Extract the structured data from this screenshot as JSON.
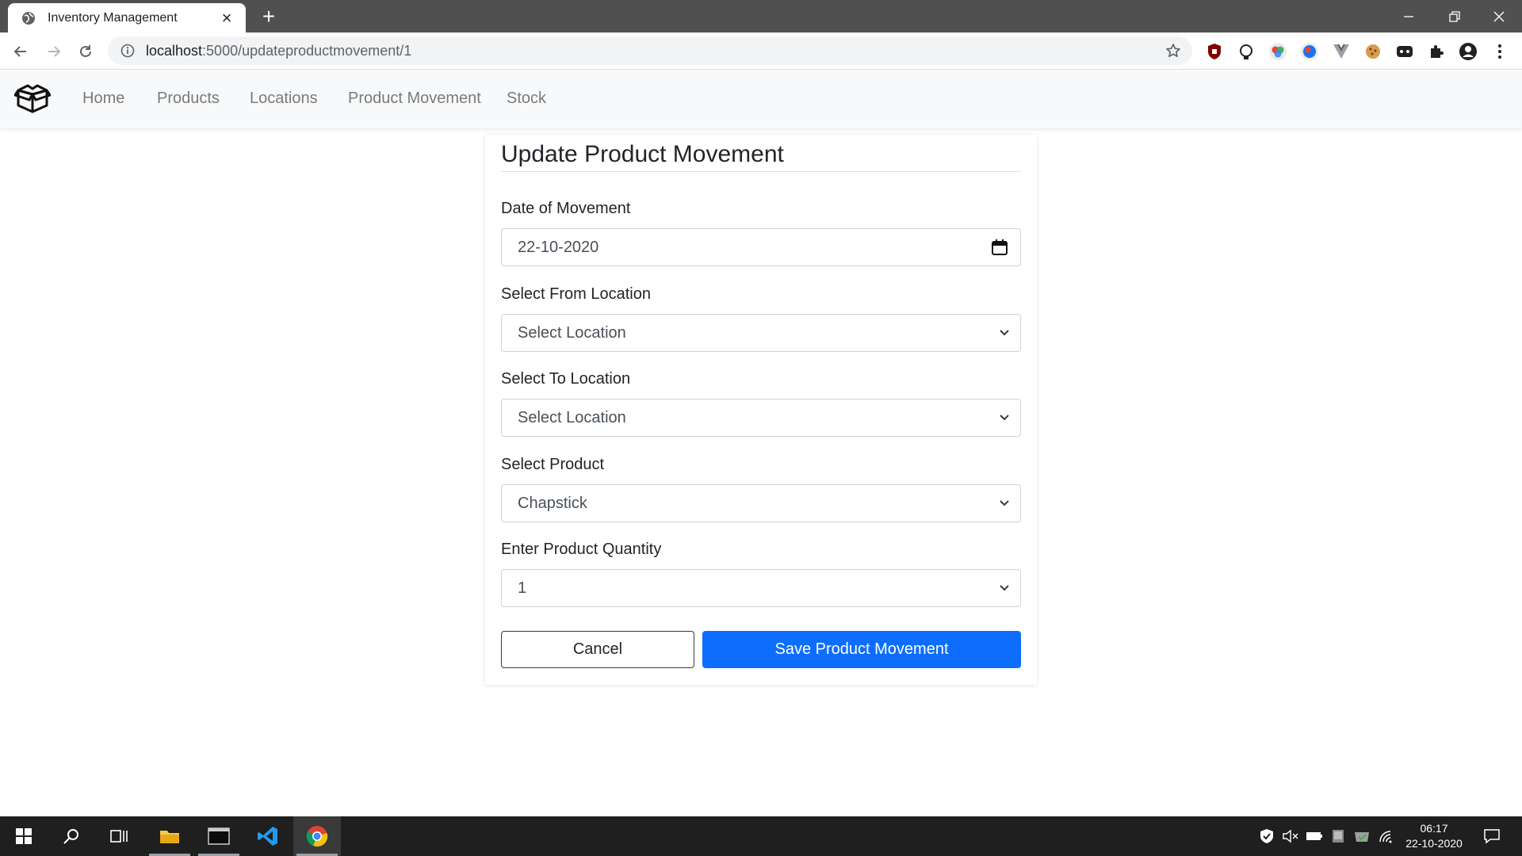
{
  "browser": {
    "tab_title": "Inventory Management",
    "tab_close": "×",
    "new_tab": "+",
    "url_host": "localhost",
    "url_path": ":5000/updateproductmovement/1"
  },
  "navbar": {
    "brand_icon": "box-icon",
    "links": [
      "Home",
      "Products",
      "Locations",
      "Product Movement",
      "Stock"
    ]
  },
  "form": {
    "title": "Update Product Movement",
    "date_label": "Date of Movement",
    "date_value": "22-10-2020",
    "from_label": "Select From Location",
    "from_value": "Select Location",
    "to_label": "Select To Location",
    "to_value": "Select Location",
    "product_label": "Select Product",
    "product_value": "Chapstick",
    "qty_label": "Enter Product Quantity",
    "qty_value": "1",
    "cancel_label": "Cancel",
    "save_label": "Save Product Movement"
  },
  "taskbar": {
    "time": "06:17",
    "date": "22-10-2020"
  },
  "colors": {
    "primary": "#0d6efd",
    "navbar_bg": "#f8f9fa",
    "tabbar_bg": "#505050",
    "taskbar_bg": "#1f1f1f"
  }
}
